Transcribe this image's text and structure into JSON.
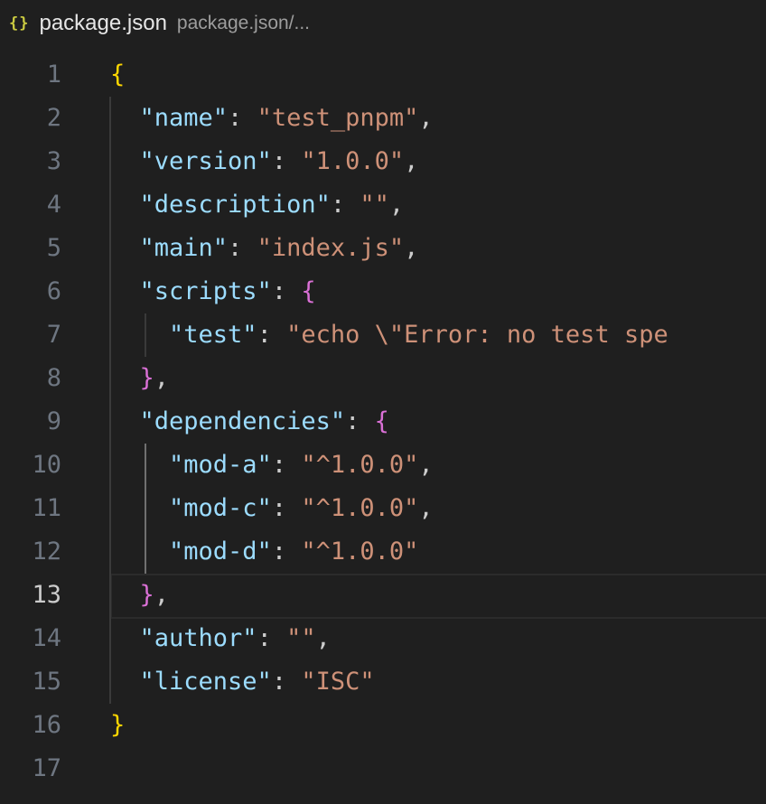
{
  "breadcrumb": {
    "icon": "json-braces-icon",
    "icon_glyph": "{}",
    "file_name": "package.json",
    "path": "package.json/..."
  },
  "editor": {
    "active_line": 13,
    "line_numbers": [
      "1",
      "2",
      "3",
      "4",
      "5",
      "6",
      "7",
      "8",
      "9",
      "10",
      "11",
      "12",
      "13",
      "14",
      "15",
      "16",
      "17"
    ],
    "lines": [
      [
        {
          "t": "b1",
          "v": "{"
        }
      ],
      [
        {
          "t": "key",
          "v": "  \"name\""
        },
        {
          "t": "punc",
          "v": ": "
        },
        {
          "t": "str",
          "v": "\"test_pnpm\""
        },
        {
          "t": "punc",
          "v": ","
        }
      ],
      [
        {
          "t": "key",
          "v": "  \"version\""
        },
        {
          "t": "punc",
          "v": ": "
        },
        {
          "t": "str",
          "v": "\"1.0.0\""
        },
        {
          "t": "punc",
          "v": ","
        }
      ],
      [
        {
          "t": "key",
          "v": "  \"description\""
        },
        {
          "t": "punc",
          "v": ": "
        },
        {
          "t": "str",
          "v": "\"\""
        },
        {
          "t": "punc",
          "v": ","
        }
      ],
      [
        {
          "t": "key",
          "v": "  \"main\""
        },
        {
          "t": "punc",
          "v": ": "
        },
        {
          "t": "str",
          "v": "\"index.js\""
        },
        {
          "t": "punc",
          "v": ","
        }
      ],
      [
        {
          "t": "key",
          "v": "  \"scripts\""
        },
        {
          "t": "punc",
          "v": ": "
        },
        {
          "t": "b2",
          "v": "{"
        }
      ],
      [
        {
          "t": "key",
          "v": "    \"test\""
        },
        {
          "t": "punc",
          "v": ": "
        },
        {
          "t": "str",
          "v": "\"echo \\\"Error: no test spe"
        }
      ],
      [
        {
          "t": "b2",
          "v": "  }"
        },
        {
          "t": "punc",
          "v": ","
        }
      ],
      [
        {
          "t": "key",
          "v": "  \"dependencies\""
        },
        {
          "t": "punc",
          "v": ": "
        },
        {
          "t": "b2",
          "v": "{"
        }
      ],
      [
        {
          "t": "key",
          "v": "    \"mod-a\""
        },
        {
          "t": "punc",
          "v": ": "
        },
        {
          "t": "str",
          "v": "\"^1.0.0\""
        },
        {
          "t": "punc",
          "v": ","
        }
      ],
      [
        {
          "t": "key",
          "v": "    \"mod-c\""
        },
        {
          "t": "punc",
          "v": ": "
        },
        {
          "t": "str",
          "v": "\"^1.0.0\""
        },
        {
          "t": "punc",
          "v": ","
        }
      ],
      [
        {
          "t": "key",
          "v": "    \"mod-d\""
        },
        {
          "t": "punc",
          "v": ": "
        },
        {
          "t": "str",
          "v": "\"^1.0.0\""
        }
      ],
      [
        {
          "t": "b2",
          "v": "  }"
        },
        {
          "t": "punc",
          "v": ","
        }
      ],
      [
        {
          "t": "key",
          "v": "  \"author\""
        },
        {
          "t": "punc",
          "v": ": "
        },
        {
          "t": "str",
          "v": "\"\""
        },
        {
          "t": "punc",
          "v": ","
        }
      ],
      [
        {
          "t": "key",
          "v": "  \"license\""
        },
        {
          "t": "punc",
          "v": ": "
        },
        {
          "t": "str",
          "v": "\"ISC\""
        }
      ],
      [
        {
          "t": "b1",
          "v": "}"
        }
      ],
      []
    ]
  },
  "colors": {
    "background": "#1f1f1f",
    "key": "#9cdcfe",
    "string": "#ce9178",
    "bracket_level1": "#ffd700",
    "bracket_level2": "#da70d6",
    "line_number": "#6e7681",
    "line_number_active": "#cccccc"
  }
}
